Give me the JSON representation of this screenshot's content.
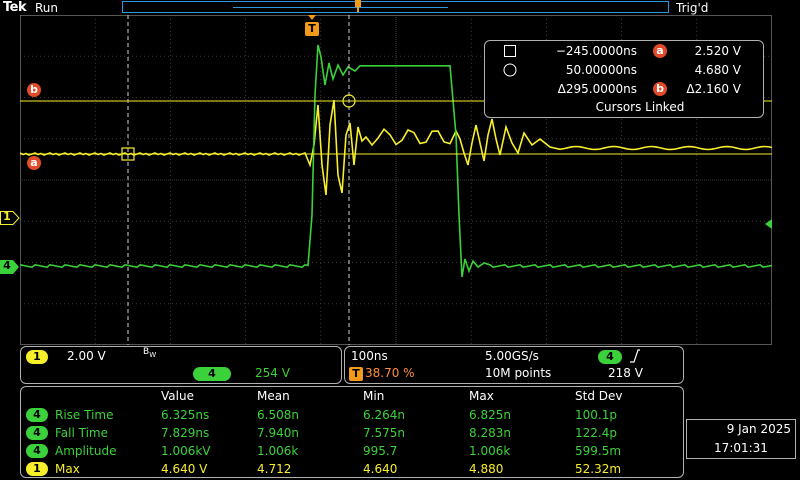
{
  "header": {
    "brand": "Tek",
    "run_state": "Run",
    "trigger_state": "Trig'd"
  },
  "colors": {
    "ch1": "#f7ee2c",
    "ch4": "#3bd13b",
    "cursor_ref": "#e24a2a",
    "grid": "#3a3a3a",
    "record_bar": "#2a9adc",
    "trigger_marker": "#f39a1a"
  },
  "markers": {
    "trigger": "T",
    "cursor_a": "a",
    "cursor_b": "b",
    "ch1": "1",
    "ch4": "4"
  },
  "cursors": {
    "a_time": "−245.0000ns",
    "a_volt": "2.520 V",
    "b_time": "50.00000ns",
    "b_volt": "4.680 V",
    "delta_time": "Δ295.0000ns",
    "delta_volt": "Δ2.160 V",
    "linked": "Cursors Linked",
    "icon_a": "square-cursor-icon",
    "icon_b": "circle-cursor-icon"
  },
  "channels": {
    "ch1_label": "1",
    "ch1_scale": "2.00 V",
    "ch1_bw": "B",
    "ch1_bw_sub": "W",
    "ch4_label": "4",
    "ch4_scale": "254 V"
  },
  "timebase": {
    "horizontal": "100ns",
    "sample_rate": "5.00GS/s",
    "trigger_position": "38.70 %",
    "record_length": "10M points",
    "trigger_source": "4",
    "trigger_slope": "rising-edge-icon",
    "trigger_level": "218 V"
  },
  "measurements": {
    "headers": [
      "Value",
      "Mean",
      "Min",
      "Max",
      "Std Dev"
    ],
    "rows": [
      {
        "ch": "4",
        "name": "Rise Time",
        "value": "6.325ns",
        "mean": "6.508n",
        "min": "6.264n",
        "max": "6.825n",
        "std": "100.1p"
      },
      {
        "ch": "4",
        "name": "Fall Time",
        "value": "7.829ns",
        "mean": "7.940n",
        "min": "7.575n",
        "max": "8.283n",
        "std": "122.4p"
      },
      {
        "ch": "4",
        "name": "Amplitude",
        "value": "1.006kV",
        "mean": "1.006k",
        "min": "995.7",
        "max": "1.006k",
        "std": "599.5m"
      },
      {
        "ch": "1",
        "name": "Max",
        "value": "4.640 V",
        "mean": "4.712",
        "min": "4.640",
        "max": "4.880",
        "std": "52.32m"
      }
    ]
  },
  "datetime": {
    "date": "9 Jan  2025",
    "time": "17:01:31"
  }
}
